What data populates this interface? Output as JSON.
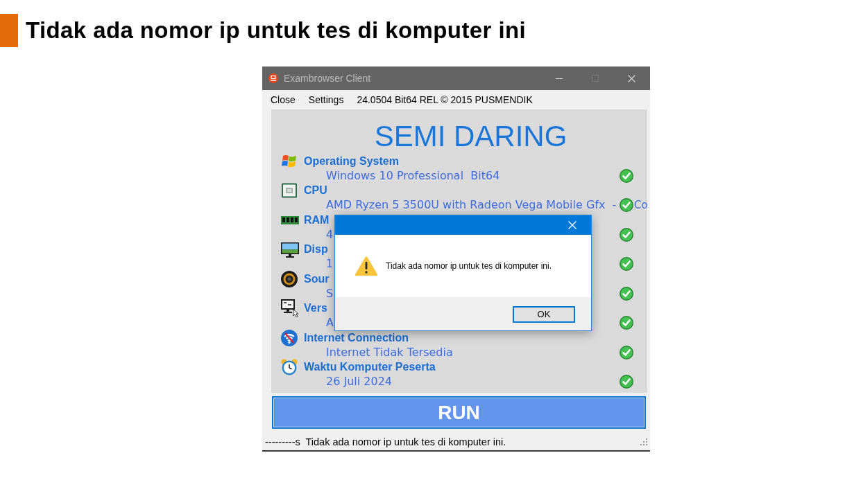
{
  "slide": {
    "title": "Tidak ada nomor ip untuk tes di komputer ini"
  },
  "window": {
    "title": "Exambrowser Client",
    "controls": [
      {
        "kind": "minimize",
        "disabled": false
      },
      {
        "kind": "maximize",
        "disabled": true
      },
      {
        "kind": "close",
        "disabled": false
      }
    ]
  },
  "menu": {
    "items": [
      {
        "label": "Close"
      },
      {
        "label": "Settings"
      }
    ],
    "version": "24.0504 Bit64 REL © 2015 PUSMENDIK"
  },
  "panel": {
    "heading": "SEMI DARING",
    "checks": [
      {
        "kind": "os",
        "title": "Operating System",
        "value": "Windows 10 Professional  Bit64",
        "ok": true
      },
      {
        "kind": "cpu",
        "title": "CPU",
        "value": "AMD Ryzen 5 3500U with Radeon Vega Mobile Gfx  -",
        "value_tail": "Co",
        "ok": true
      },
      {
        "kind": "ram",
        "title": "RAM",
        "value": "4",
        "ok": true
      },
      {
        "kind": "display",
        "title": "Disp",
        "value": "1",
        "ok": true
      },
      {
        "kind": "sound",
        "title": "Sour",
        "value": "S",
        "ok": true
      },
      {
        "kind": "version",
        "title": "Vers",
        "value": "A",
        "ok": true
      },
      {
        "kind": "internet",
        "title": "Internet Connection",
        "value": "Internet Tidak Tersedia",
        "ok": true
      },
      {
        "kind": "clock",
        "title": "Waktu Komputer Peserta",
        "value": "26 Juli 2024",
        "ok": true
      }
    ]
  },
  "run_button": {
    "label": "RUN"
  },
  "status_bar": {
    "text": "---------s  Tidak ada nomor ip untuk tes di komputer ini."
  },
  "dialog": {
    "kind": "warning",
    "message": "Tidak ada nomor ip untuk tes di komputer ini.",
    "button": "OK"
  }
}
